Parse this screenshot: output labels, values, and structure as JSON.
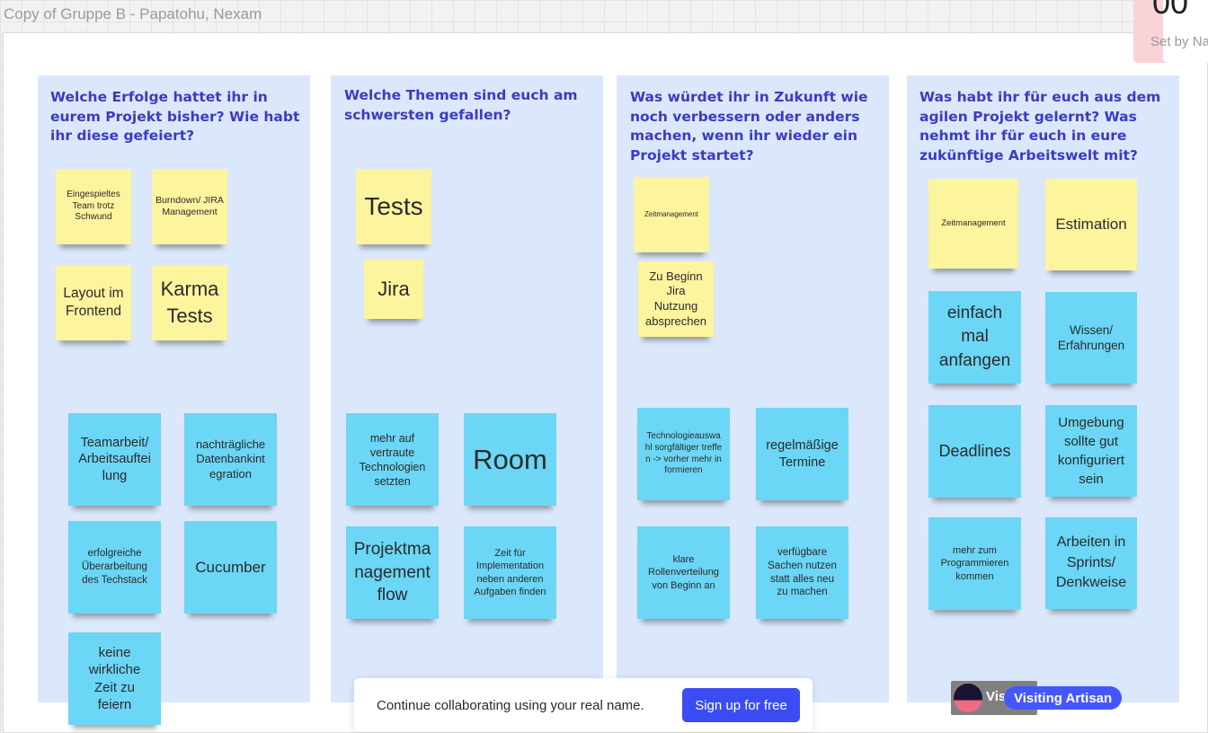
{
  "board": {
    "title": "Copy of Gruppe B - Papatohu, Nexam"
  },
  "timer": {
    "value": "00",
    "set_by": "Set by Na"
  },
  "columns": [
    {
      "title": "Welche Erfolge hattet ihr in eurem Projekt bisher? Wie habt ihr diese gefeiert?",
      "notes": [
        "Eingespieltes Team trotz Schwund",
        "Burndown/ JIRA Management",
        "Layout im Frontend",
        "Karma Tests",
        "Teamarbeit/ Arbeitsaufteilung",
        "nachträgliche Datenbankintegration",
        "erfolgreiche Überarbeitung des Techstack",
        "Cucumber",
        "keine wirkliche Zeit zu feiern"
      ]
    },
    {
      "title": "Welche Themen sind euch am schwersten gefallen?",
      "notes": [
        "Tests",
        "Jira",
        "mehr auf vertraute Technologien setzten",
        "Room",
        "Projektmanagementflow",
        "Zeit für Implementation neben anderen Aufgaben finden"
      ]
    },
    {
      "title": "Was würdet ihr in Zukunft wie noch verbessern oder anders machen, wenn ihr wieder ein Projekt startet?",
      "notes": [
        "Zeitmanagement",
        "Zu Beginn Jira Nutzung absprechen",
        "Technologieauswahl sorgfältiger treffen -> vorher mehr informieren",
        "regelmäßige Termine",
        "klare Rollenverteilung von Beginn an",
        "verfügbare Sachen nutzen statt alles neu zu machen"
      ]
    },
    {
      "title": "Was habt ihr für euch aus dem agilen Projekt gelernt? Was nehmt ihr für euch in eure zukünftige Arbeitswelt mit?",
      "notes": [
        "Zeitmanagement",
        "Estimation",
        "einfach mal anfangen",
        "Wissen/ Erfahrungen",
        "Deadlines",
        "Umgebung sollte gut konfiguriert sein",
        "mehr zum Programmieren kommen",
        "Arbeiten in Sprints/ Denkweise"
      ]
    }
  ],
  "banner": {
    "text": "Continue collaborating using your real name.",
    "button": "Sign up for free"
  },
  "visitor": {
    "short": "Vis",
    "label": "Visiting Artisan"
  },
  "colors": {
    "yellow": "#fdf49e",
    "blue": "#6bd6f5",
    "column_bg": "#dbe8fb",
    "title": "#3d3ac4",
    "signup": "#3b4cf2"
  }
}
